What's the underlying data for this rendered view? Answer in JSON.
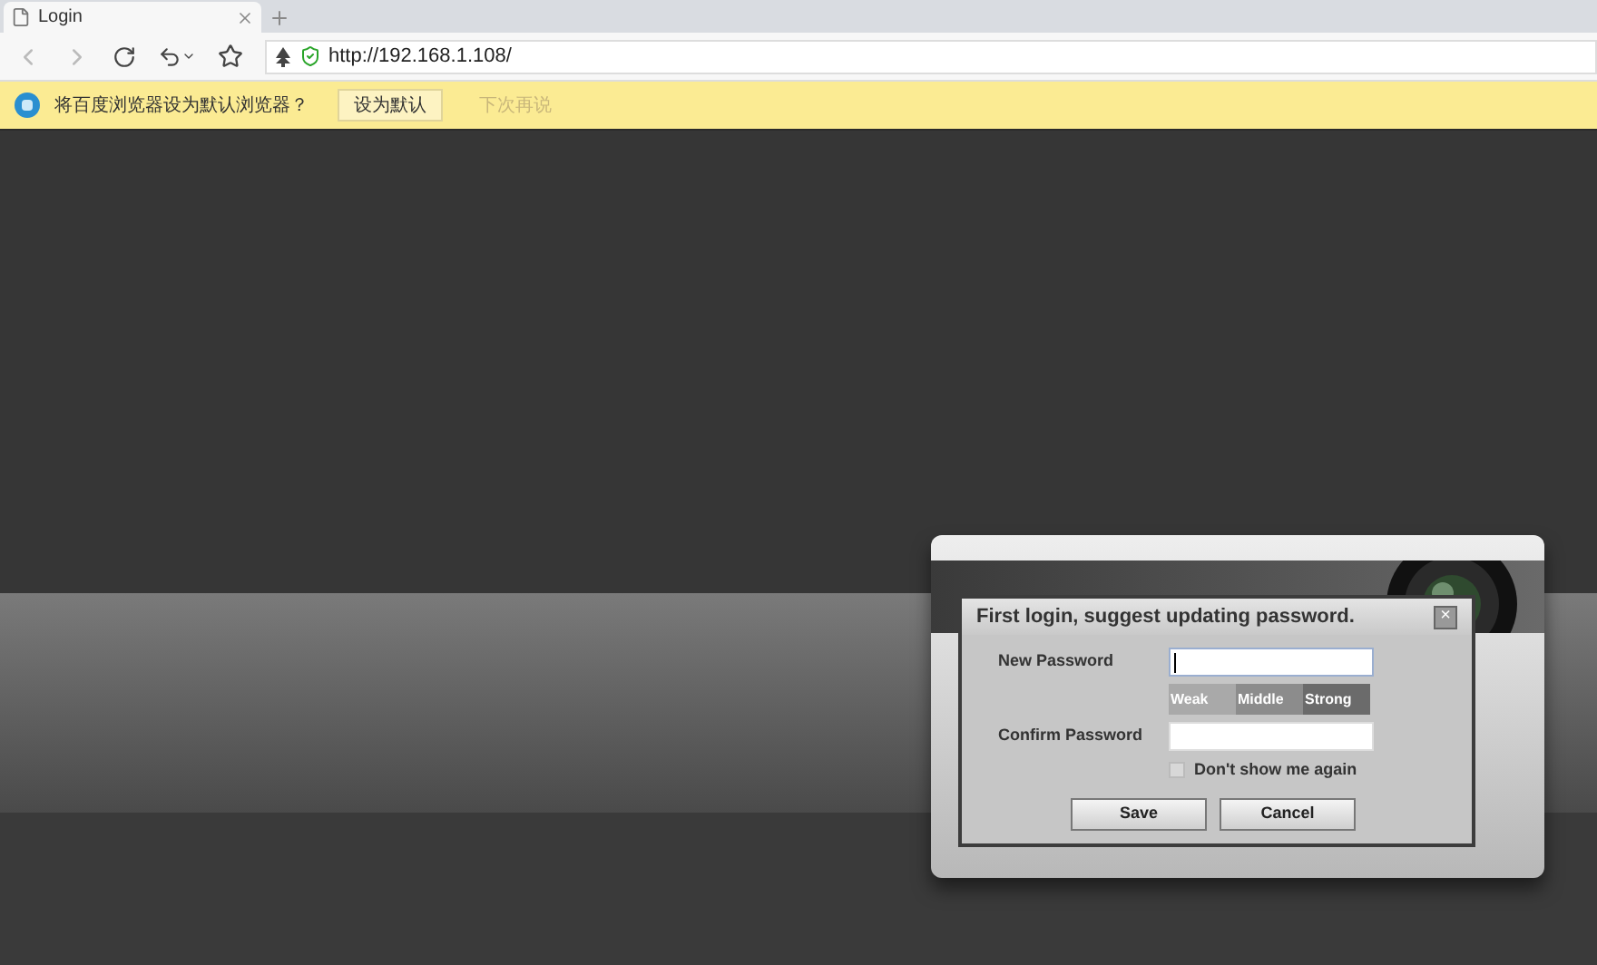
{
  "tabs": [
    {
      "title": "Login",
      "selected": true
    }
  ],
  "address_bar": {
    "url": "http://192.168.1.108/"
  },
  "infobar": {
    "message": "将百度浏览器设为默认浏览器？",
    "button": "设为默认",
    "later": "下次再说"
  },
  "dialog": {
    "title": "First login, suggest updating password.",
    "close": "×",
    "fields": [
      {
        "label": "New Password",
        "focused": true
      },
      {
        "label": "Confirm Password",
        "focused": false
      }
    ],
    "strength": [
      {
        "label": "Weak",
        "color": "#a9a9a9"
      },
      {
        "label": "Middle",
        "color": "#8c8c8c"
      },
      {
        "label": "Strong",
        "color": "#6b6b6b"
      }
    ],
    "dont_show": {
      "label": "Don't show me again",
      "checked": false
    },
    "buttons": [
      "Save",
      "Cancel"
    ]
  }
}
